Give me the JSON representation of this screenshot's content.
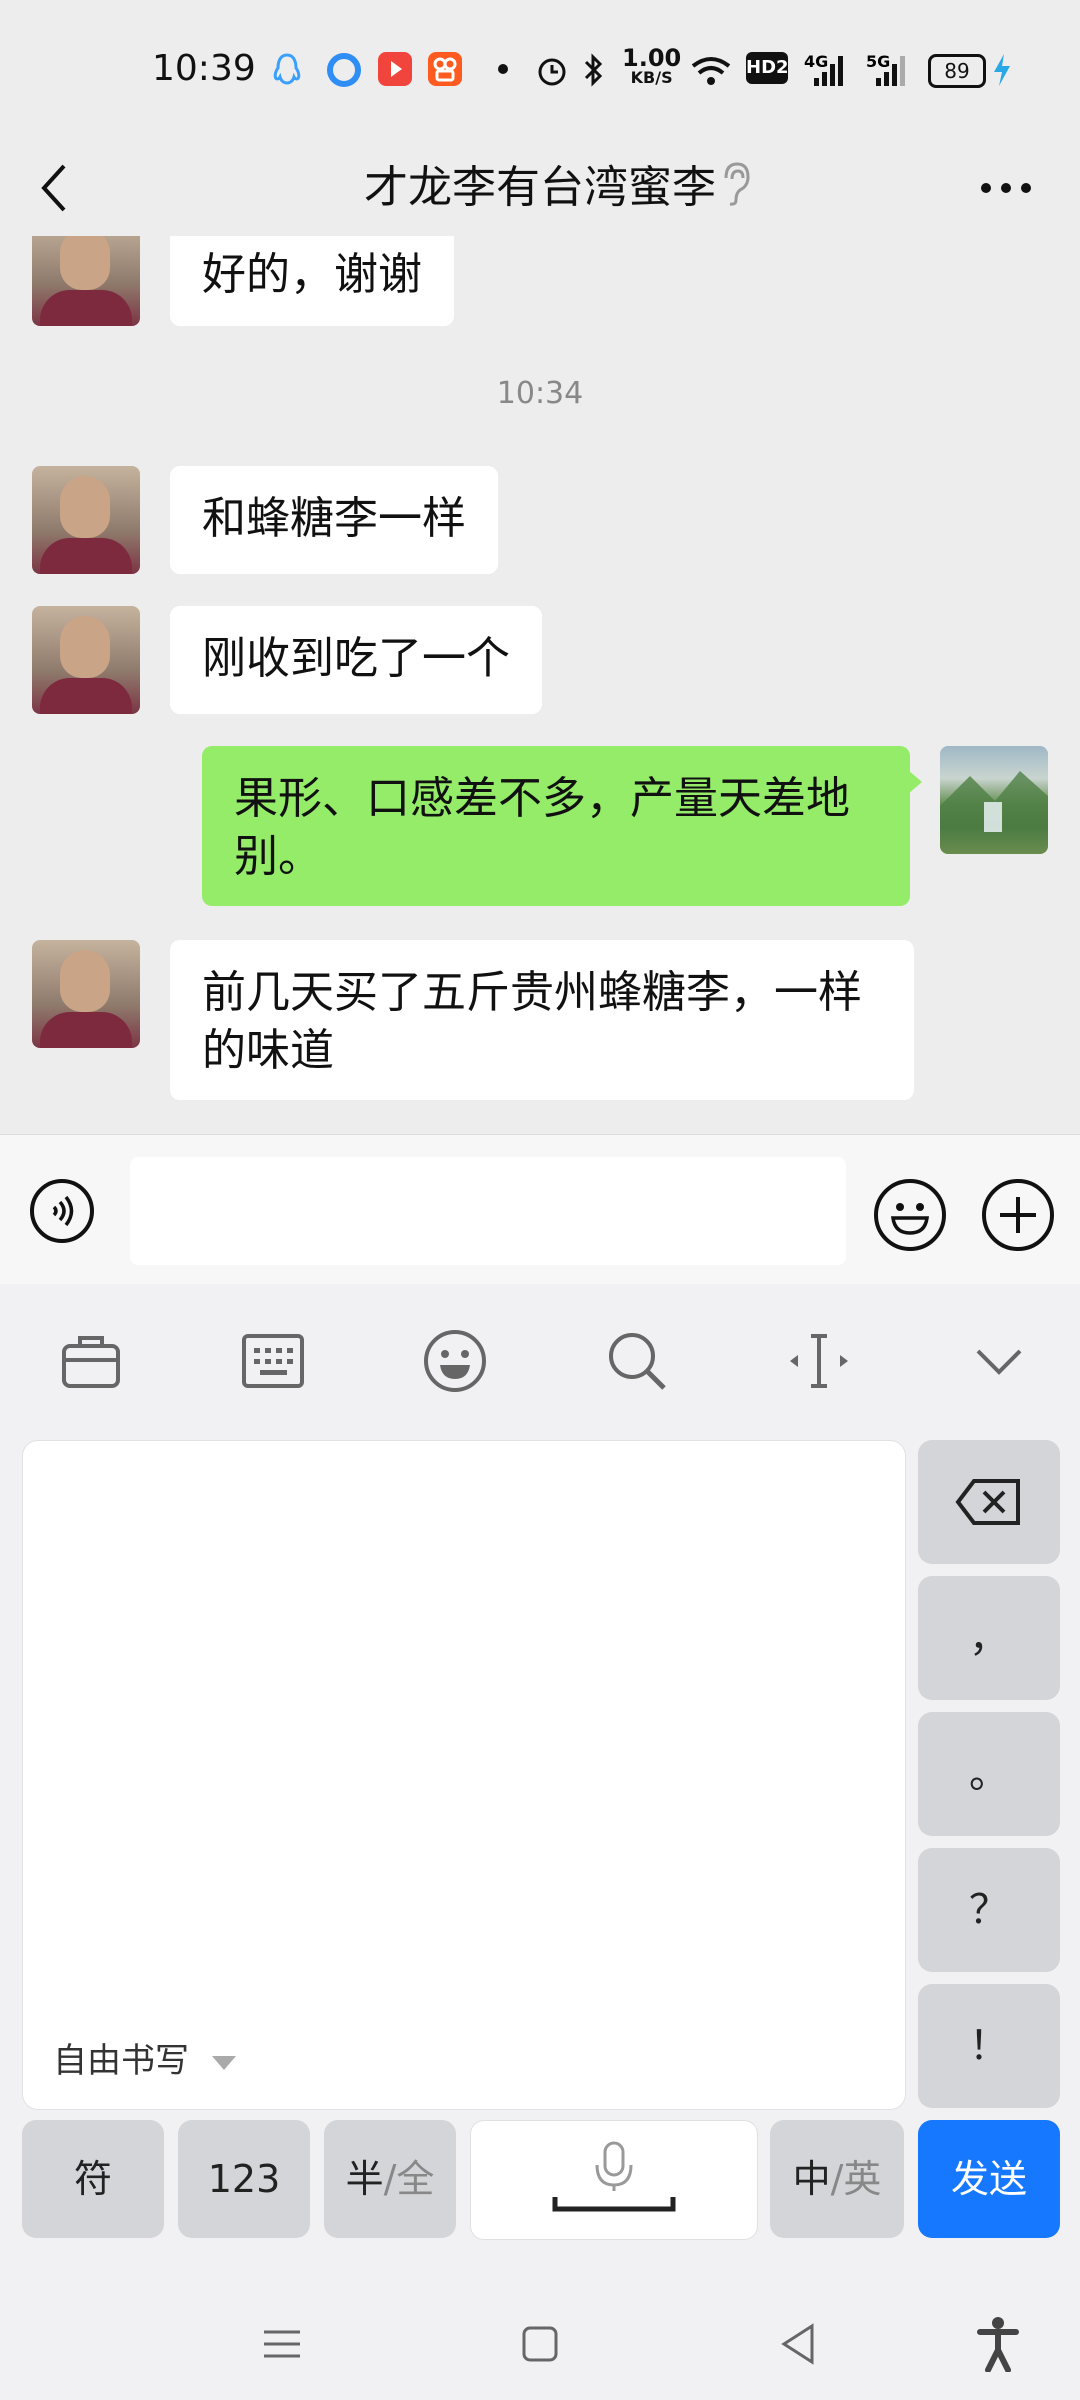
{
  "status_bar": {
    "time": "10:39",
    "net_speed_value": "1.00",
    "net_speed_unit": "KB/S",
    "network_hd": "HD2",
    "network_4g": "4G",
    "network_5g": "5G",
    "battery": "89"
  },
  "nav": {
    "title": "才龙李有台湾蜜李",
    "back_icon": "chevron-left-icon",
    "ear_icon": "ear-icon",
    "more_icon": "more-dots-icon"
  },
  "messages": [
    {
      "side": "left",
      "text": "好的，谢谢"
    },
    {
      "timestamp": "10:34"
    },
    {
      "side": "left",
      "text": "和蜂糖李一样"
    },
    {
      "side": "left",
      "text": "刚收到吃了一个"
    },
    {
      "side": "right",
      "text": "果形、口感差不多，产量天差地别。"
    },
    {
      "side": "left",
      "text": "前几天买了五斤贵州蜂糖李，一样的味道"
    }
  ],
  "input": {
    "value": "",
    "voice_icon": "voice-icon",
    "emoji_icon": "emoji-icon",
    "plus_icon": "plus-icon"
  },
  "keyboard": {
    "toolbar": [
      "briefcase-icon",
      "keyboard-icon",
      "emoji-icon",
      "search-icon",
      "cursor-icon",
      "collapse-icon"
    ],
    "handwriting_mode": "自由书写",
    "side_keys": [
      "backspace",
      "，",
      "。",
      "？",
      "！"
    ],
    "bottom_keys": {
      "symbols": "符",
      "numbers": "123",
      "half": "半",
      "full": "全",
      "chinese": "中",
      "english": "英",
      "send": "发送"
    }
  },
  "colors": {
    "incoming_bubble": "#ffffff",
    "outgoing_bubble": "#95ec69",
    "send_button": "#1677ff",
    "background": "#ededed"
  }
}
